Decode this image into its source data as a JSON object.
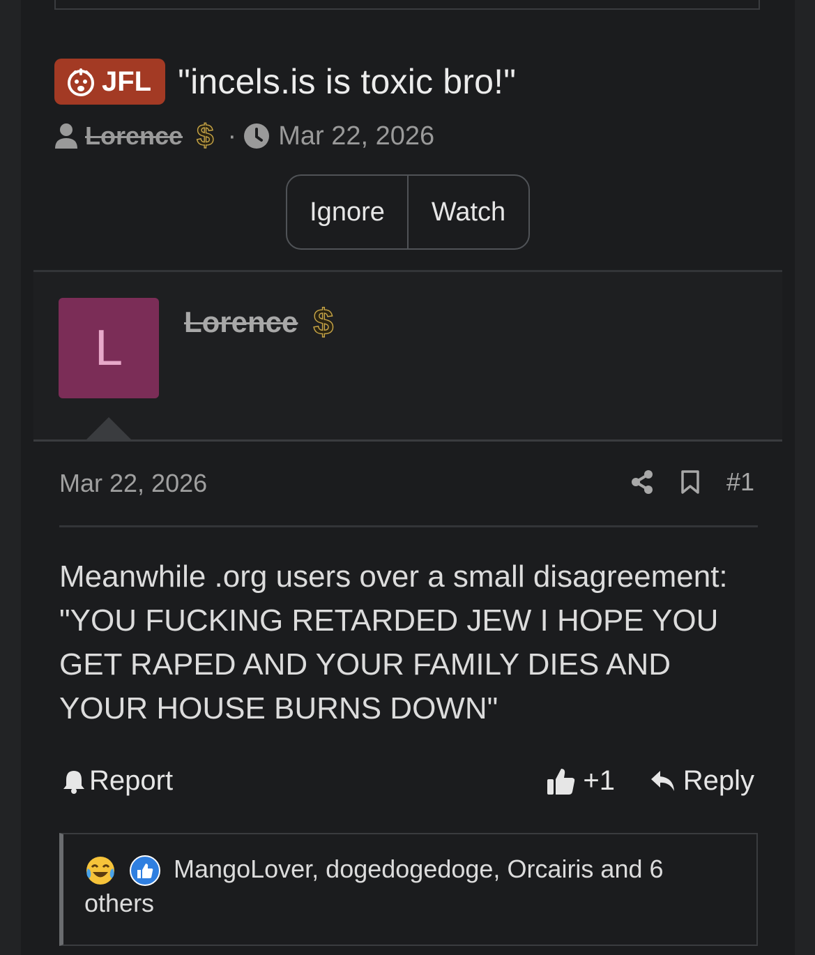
{
  "thread": {
    "prefix": "JFL",
    "title": "\"incels.is is toxic bro!\"",
    "author": "Lorence",
    "dollar_symbol": "$",
    "separator": "·",
    "date": "Mar 22, 2026"
  },
  "thread_actions": {
    "ignore": "Ignore",
    "watch": "Watch"
  },
  "post": {
    "avatar_letter": "L",
    "username": "Lorence",
    "dollar_symbol": "$",
    "date": "Mar 22, 2026",
    "number": "#1",
    "body_lines": [
      "Meanwhile .org users over a small disagreement:",
      "\"YOU FUCKING RETARDED JEW I HOPE YOU",
      "GET RAPED AND YOUR FAMILY DIES AND",
      "YOUR HOUSE BURNS DOWN\""
    ],
    "report_label": "Report",
    "like_label": "+1",
    "reply_label": "Reply",
    "reactions_text": "MangoLover, dogedogedoge, Orcairis and 6 others"
  },
  "colors": {
    "prefix_bg": "#a33a24",
    "avatar_bg": "#7b2d57",
    "dollar_outline": "#c9a647",
    "like_reaction": "#2f7fe0"
  },
  "icons": [
    "mind-blown-icon",
    "user-icon",
    "dollar-icon",
    "clock-icon",
    "share-icon",
    "bookmark-icon",
    "bell-icon",
    "thumbs-up-icon",
    "reply-icon",
    "laugh-cry-emoji-icon",
    "like-reaction-icon"
  ]
}
